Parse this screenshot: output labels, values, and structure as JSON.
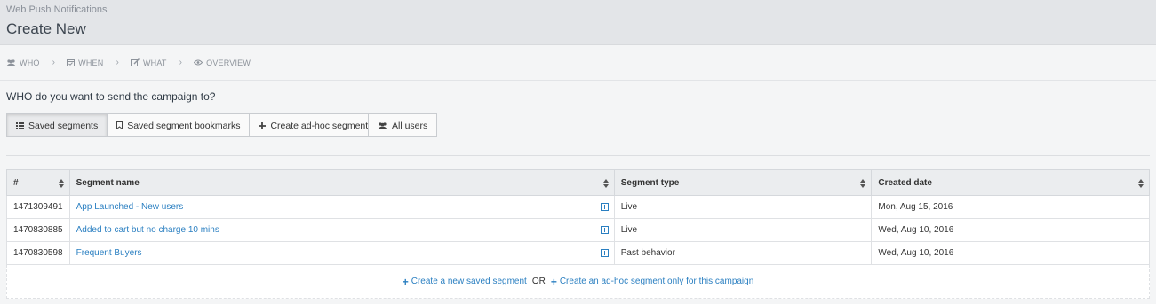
{
  "header": {
    "subtitle": "Web Push Notifications",
    "title": "Create New"
  },
  "steps": [
    {
      "label": "WHO",
      "icon": "users-icon"
    },
    {
      "label": "WHEN",
      "icon": "calendar-icon"
    },
    {
      "label": "WHAT",
      "icon": "edit-icon"
    },
    {
      "label": "OVERVIEW",
      "icon": "eye-icon"
    }
  ],
  "step_separator": "›",
  "question": "WHO do you want to send the campaign to?",
  "segment_tabs": {
    "saved": "Saved segments",
    "bookmarks": "Saved segment bookmarks",
    "adhoc": "Create ad-hoc segment",
    "all_users": "All users"
  },
  "table": {
    "columns": [
      "#",
      "Segment name",
      "Segment type",
      "Created date"
    ],
    "rows": [
      {
        "id": "1471309491",
        "name": "App Launched - New users",
        "type": "Live",
        "created": "Mon, Aug 15, 2016"
      },
      {
        "id": "1470830885",
        "name": "Added to cart but no charge 10 mins",
        "type": "Live",
        "created": "Wed, Aug 10, 2016"
      },
      {
        "id": "1470830598",
        "name": "Frequent Buyers",
        "type": "Past behavior",
        "created": "Wed, Aug 10, 2016"
      }
    ]
  },
  "footer": {
    "create_saved": "Create a new saved segment",
    "or": "OR",
    "create_adhoc": "Create an ad-hoc segment only for this campaign"
  },
  "colors": {
    "link": "#2a7fc1",
    "header_bg": "#e3e5e8",
    "page_bg": "#f4f5f6"
  }
}
